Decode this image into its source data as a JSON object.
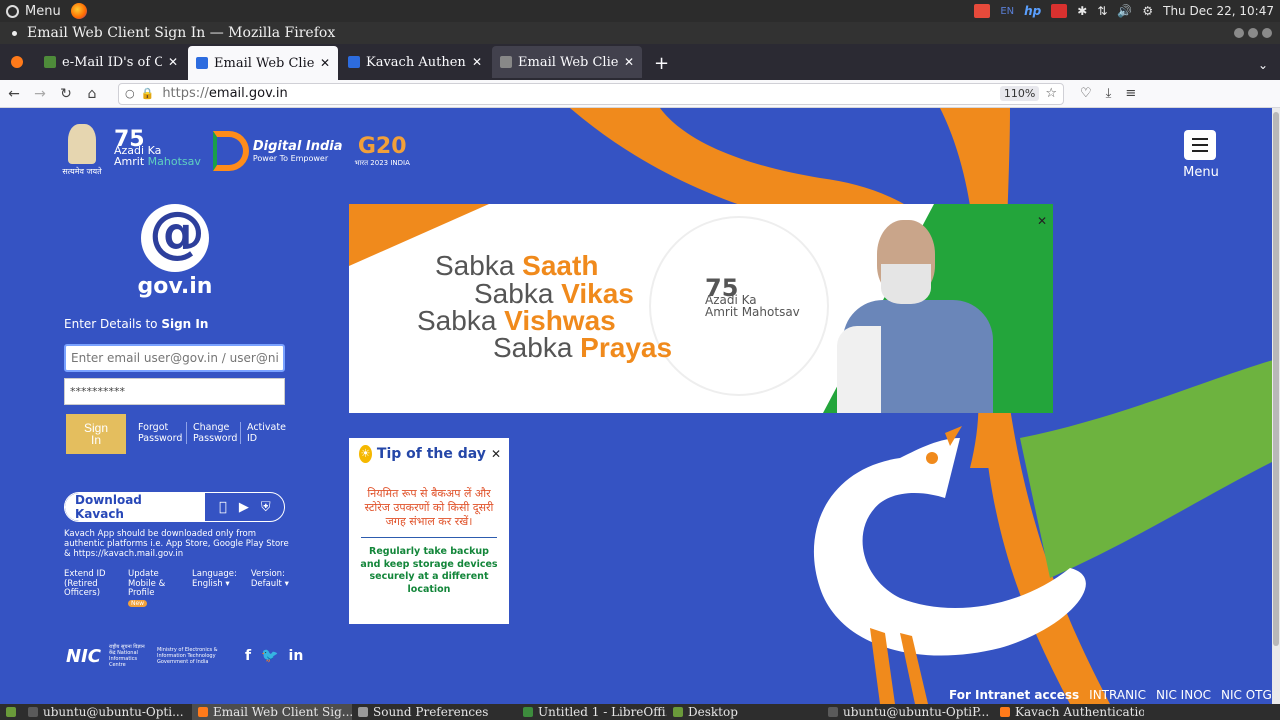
{
  "os_panel": {
    "menu_label": "Menu",
    "clock": "Thu Dec 22, 10:47",
    "keyboard_layout": "EN"
  },
  "window": {
    "title": "Email Web Client Sign In — Mozilla Firefox"
  },
  "tabs": [
    {
      "label": "e-Mail ID's of Courts",
      "favicon_color": "#4e8b3a"
    },
    {
      "label": "Email Web Client Sign In",
      "favicon_color": "#2d6cdf",
      "active": true
    },
    {
      "label": "Kavach Authentication",
      "favicon_color": "#2d6cdf"
    },
    {
      "label": "Email Web Client Sign In",
      "favicon_color": "#888888",
      "hover": true
    }
  ],
  "navbar": {
    "url_protocol": "https://",
    "url_host": "email.gov.in",
    "zoom": "110%"
  },
  "header": {
    "emblem_caption": "सत्यमेव जयते",
    "azadi": {
      "number": "75",
      "line1": "Azadi",
      "ka": "Ka",
      "line2": "Amrit",
      "mahotsav": "Mahotsav"
    },
    "digital_india": {
      "title": "Digital India",
      "subtitle": "Power To Empower"
    },
    "g20": {
      "title": "G20",
      "subtitle": "भारत 2023 INDIA"
    },
    "menu_label": "Menu"
  },
  "signin": {
    "logo_text": "gov.in",
    "heading_prefix": "Enter Details to ",
    "heading_bold": "Sign In",
    "email_placeholder": "Enter email user@gov.in / user@nic.in",
    "password_value": "**********",
    "signin_button": "Sign In",
    "links": [
      "Forgot Password",
      "Change Password",
      "Activate ID"
    ]
  },
  "kavach": {
    "button_label": "Download Kavach",
    "note": "Kavach App should be downloaded only from authentic platforms i.e. App Store, Google Play Store & https://kavach.mail.gov.in"
  },
  "footer": {
    "extend_id": "Extend ID (Retired Officers)",
    "update_profile": "Update Mobile & Profile",
    "new_badge": "New",
    "language_label": "Language:",
    "language_value": "English",
    "version_label": "Version:",
    "version_value": "Default",
    "nic_mark": "NIC",
    "nic_text": "राष्ट्रीय सूचना विज्ञान केंद्र National Informatics Centre",
    "meity_text": "Ministry of Electronics & Information Technology Government of India"
  },
  "banner": {
    "lines": [
      {
        "prefix": "Sabka ",
        "word": "Saath"
      },
      {
        "prefix": "Sabka ",
        "word": "Vikas"
      },
      {
        "prefix": "Sabka ",
        "word": "Vishwas"
      },
      {
        "prefix": "Sabka ",
        "word": "Prayas"
      }
    ],
    "badge_number": "75",
    "badge_azadi": "Azadi",
    "badge_ka": "Ka",
    "badge_amrit": "Amrit",
    "badge_mahotsav": "Mahotsav"
  },
  "tip": {
    "title": "Tip of the day",
    "hindi": "नियमित रूप से बैकअप लें और स्टोरेज उपकरणों को किसी दूसरी जगह संभाल कर रखें।",
    "english": "Regularly take backup and keep storage devices securely at a different location"
  },
  "intranet": {
    "label": "For Intranet access",
    "links": [
      "INTRANIC",
      "NIC INOC",
      "NIC OTG"
    ]
  },
  "taskbar": [
    {
      "label": "ubuntu@ubuntu-Opti...",
      "icon_color": "#5a5a5a"
    },
    {
      "label": "Email Web Client Sig...",
      "icon_color": "#ff7a1a",
      "active": true
    },
    {
      "label": "Sound Preferences",
      "icon_color": "#9a9a9a"
    },
    {
      "label": "Untitled 1 - LibreOffi...",
      "icon_color": "#3d8c3d"
    },
    {
      "label": "Desktop",
      "icon_color": "#6a9a3a"
    },
    {
      "label": "ubuntu@ubuntu-OptiP...",
      "icon_color": "#5a5a5a"
    },
    {
      "label": "Kavach Authentication",
      "icon_color": "#ff7a1a"
    }
  ],
  "colors": {
    "page_bg": "#3553c3",
    "saffron": "#f08a1c",
    "green": "#23a53b",
    "signin_button": "#e4be5e"
  }
}
